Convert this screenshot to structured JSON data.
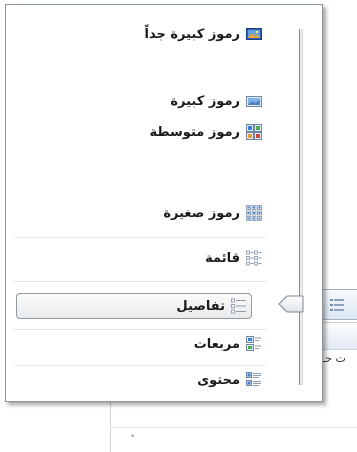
{
  "menu": {
    "items": [
      {
        "label": "رموز كبيرة جداً",
        "icon": "extra-large-icons-icon"
      },
      {
        "label": "رموز كبيرة",
        "icon": "large-icons-icon"
      },
      {
        "label": "رموز متوسطة",
        "icon": "medium-icons-icon"
      },
      {
        "label": "رموز صغيرة",
        "icon": "small-icons-icon"
      },
      {
        "label": "قائمة",
        "icon": "list-icon"
      },
      {
        "label": "تفاصيل",
        "icon": "details-icon",
        "selected": true
      },
      {
        "label": "مربعات",
        "icon": "tiles-icon"
      },
      {
        "label": "محتوى",
        "icon": "content-icon"
      }
    ]
  },
  "slider": {
    "selected_view": "تفاصيل"
  },
  "background": {
    "text_fragment": "ت حـ"
  },
  "colors": {
    "selection_border": "#8e9aa6",
    "menu_border": "#8b949e",
    "icon_blue": "#3b7dd8"
  }
}
